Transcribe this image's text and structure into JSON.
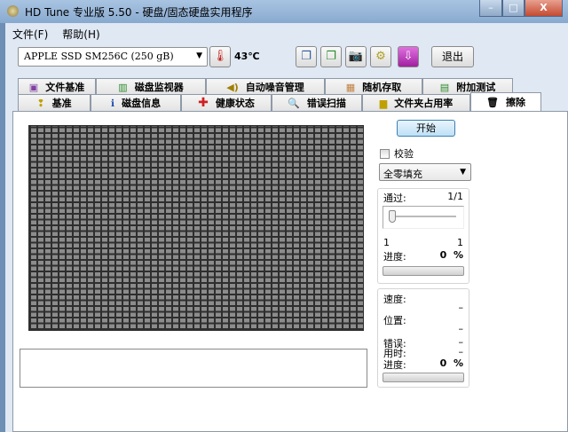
{
  "window": {
    "title": "HD Tune 专业版 5.50 - 硬盘/固态硬盘实用程序",
    "min": "–",
    "max": "□",
    "close": "X"
  },
  "menu": [
    "文件(F)",
    "帮助(H)"
  ],
  "toolbar": {
    "drive": "APPLE SSD SM256C (250 gB)",
    "temperature": "43℃",
    "exit": "退出"
  },
  "tabs_row1": [
    "文件基准",
    "磁盘监视器",
    "自动噪音管理",
    "随机存取",
    "附加测试"
  ],
  "tabs_row2": [
    "基准",
    "磁盘信息",
    "健康状态",
    "错误扫描",
    "文件夹占用率",
    "擦除"
  ],
  "erase": {
    "start": "开始",
    "verify": "校验",
    "fill_mode": "全零填充",
    "pass_label": "通过:",
    "pass_value": "1/1",
    "slider_min": "1",
    "slider_max": "1",
    "slider_value": 1,
    "progress_label": "进度:",
    "progress_value": "0",
    "percent": "%",
    "progress_fraction": 0,
    "speed_label": "速度:",
    "speed_value": "–",
    "position_label": "位置:",
    "position_value": "–",
    "errors_label": "错误:",
    "errors_value": "–",
    "time_label": "用时:",
    "time_value": "–",
    "progress2_label": "进度:",
    "progress2_value": "0",
    "progress2_fraction": 0
  }
}
